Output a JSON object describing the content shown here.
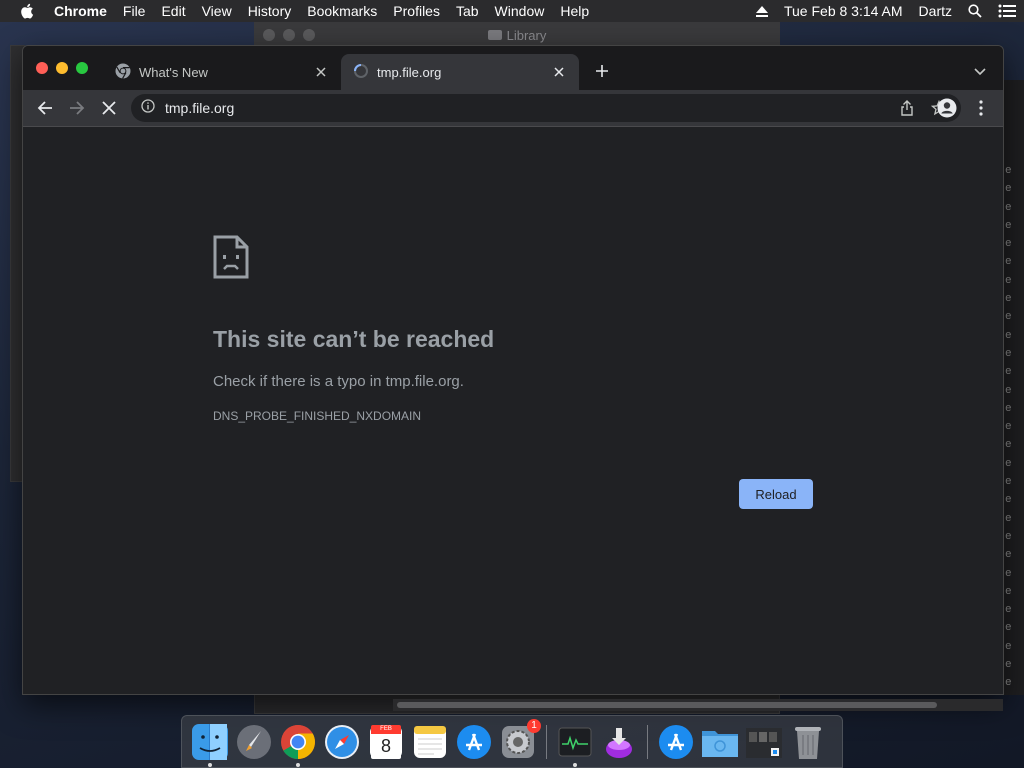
{
  "menubar": {
    "app_name": "Chrome",
    "menus": [
      "File",
      "Edit",
      "View",
      "History",
      "Bookmarks",
      "Profiles",
      "Tab",
      "Window",
      "Help"
    ],
    "clock": "Tue Feb 8  3:14 AM",
    "user": "Dartz"
  },
  "background_window": {
    "title": "Library"
  },
  "browser": {
    "tabs": [
      {
        "title": "What's New",
        "icon": "chrome-icon"
      },
      {
        "title": "tmp.file.org",
        "icon": "loading-spinner-icon"
      }
    ],
    "omnibox": {
      "url": "tmp.file.org"
    }
  },
  "error_page": {
    "heading": "This site can’t be reached",
    "message": "Check if there is a typo in tmp.file.org.",
    "code": "DNS_PROBE_FINISHED_NXDOMAIN",
    "reload_label": "Reload"
  },
  "dock": {
    "apps": [
      "finder-icon",
      "launchpad-icon",
      "chrome-icon",
      "safari-icon",
      "calendar-icon",
      "notes-icon",
      "app-store-icon",
      "system-preferences-icon",
      "activity-monitor-icon",
      "installer-icon",
      "app-store-downloads-icon",
      "folder-icon",
      "files-icon",
      "trash-icon"
    ],
    "calendar": {
      "month": "FEB",
      "day": "8"
    },
    "system_preferences_badge": "1"
  },
  "colors": {
    "accent": "#8ab4f8",
    "page_background": "#202124",
    "toolbar": "#35363a"
  }
}
